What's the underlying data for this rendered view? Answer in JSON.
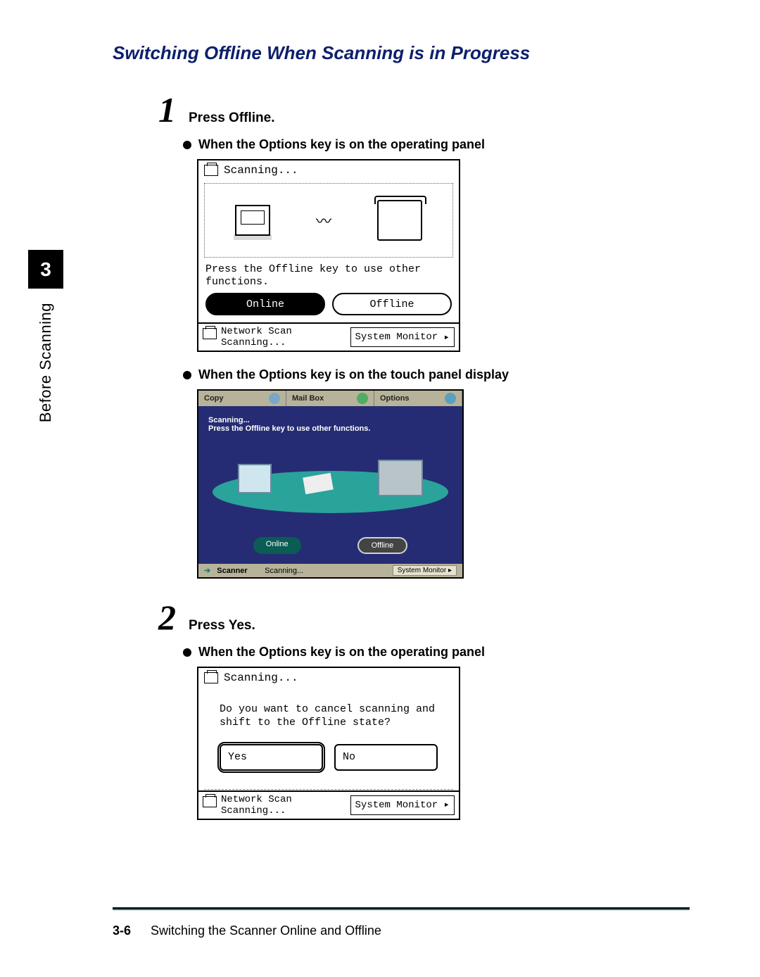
{
  "title": "Switching Offline When Scanning is in Progress",
  "sidebar": {
    "chapter": "3",
    "label": "Before Scanning"
  },
  "steps": [
    {
      "num": "1",
      "text": "Press Offline."
    },
    {
      "num": "2",
      "text": "Press Yes."
    }
  ],
  "bullets": {
    "op_panel": "When the Options key is on the operating panel",
    "touch_panel": "When the Options key is on the touch panel display"
  },
  "screen1": {
    "title": "Scanning...",
    "hint": "Press the Offline key to use other functions.",
    "buttons": {
      "online": "Online",
      "offline": "Offline"
    },
    "footer": {
      "mode": "Network Scan",
      "status": "Scanning...",
      "sys": "System Monitor"
    }
  },
  "touch": {
    "tabs": {
      "copy": "Copy",
      "mailbox": "Mail Box",
      "options": "Options"
    },
    "msg1": "Scanning...",
    "msg2": "Press the Offline key to use other functions.",
    "buttons": {
      "online": "Online",
      "offline": "Offline"
    },
    "footer": {
      "mode": "Scanner",
      "status": "Scanning...",
      "sys": "System Monitor"
    }
  },
  "screen2": {
    "title": "Scanning...",
    "msg": "Do you want to cancel scanning and shift to the Offline state?",
    "buttons": {
      "yes": "Yes",
      "no": "No"
    },
    "footer": {
      "mode": "Network Scan",
      "status": "Scanning...",
      "sys": "System Monitor"
    }
  },
  "page_footer": {
    "num": "3-6",
    "title": "Switching the Scanner Online and Offline"
  }
}
